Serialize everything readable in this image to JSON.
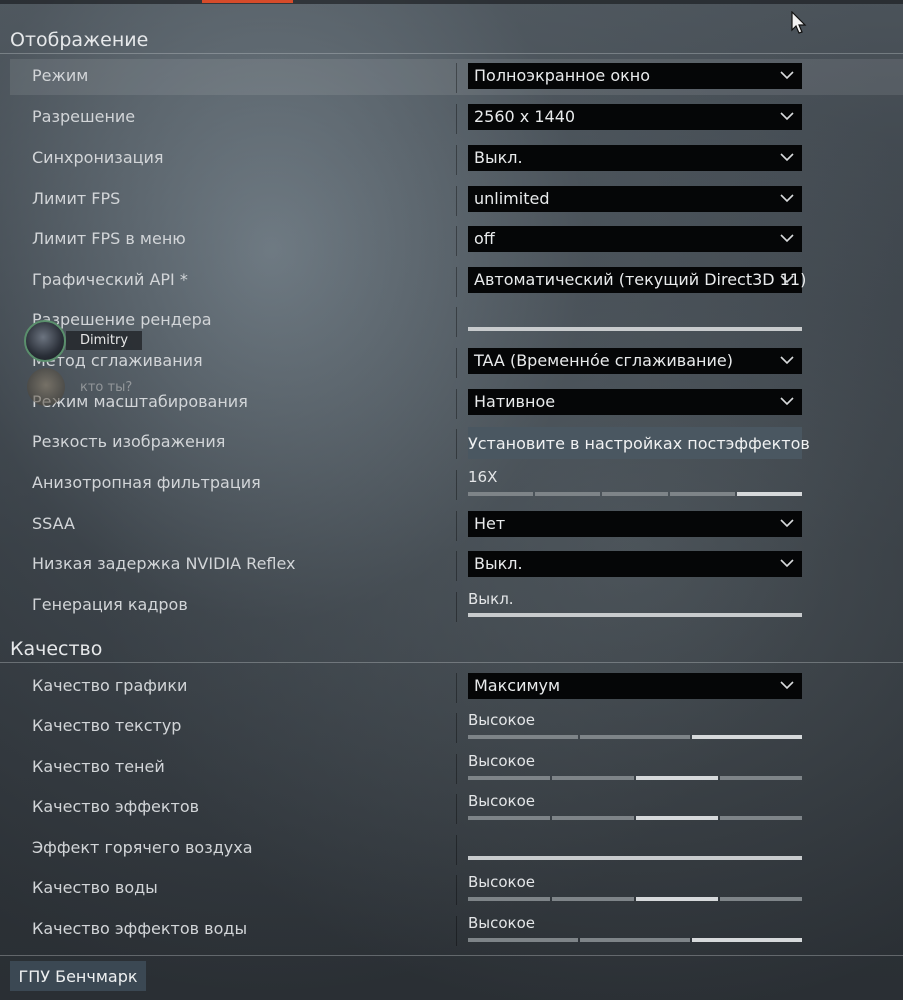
{
  "sections": {
    "display": "Отображение",
    "quality": "Качество"
  },
  "rows": {
    "mode": {
      "label": "Режим",
      "value": "Полноэкранное окно"
    },
    "resolution": {
      "label": "Разрешение",
      "value": "2560 x 1440"
    },
    "vsync": {
      "label": "Синхронизация",
      "value": "Выкл."
    },
    "fps_limit": {
      "label": "Лимит FPS",
      "value": "unlimited"
    },
    "fps_limit_menu": {
      "label": "Лимит FPS в меню",
      "value": "off"
    },
    "graphics_api": {
      "label": "Графический API *",
      "value": "Автоматический (текущий Direct3D 11)"
    },
    "render_res": {
      "label": "Разрешение рендера"
    },
    "antialias": {
      "label": "Метод сглаживания",
      "value": "TAA (Временно́е сглаживание)"
    },
    "scaling": {
      "label": "Режим масштабирования",
      "value": "Нативное"
    },
    "sharpness": {
      "label": "Резкость изображения",
      "button": "Установите в настройках постэффектов"
    },
    "anisotropic": {
      "label": "Анизотропная фильтрация",
      "value": "16X",
      "level": 5,
      "steps": 5
    },
    "ssaa": {
      "label": "SSAA",
      "value": "Нет"
    },
    "reflex": {
      "label": "Низкая задержка NVIDIA Reflex",
      "value": "Выкл."
    },
    "framegen": {
      "label": "Генерация кадров",
      "value": "Выкл."
    },
    "gfx_quality": {
      "label": "Качество графики",
      "value": "Максимум"
    },
    "texture_quality": {
      "label": "Качество текстур",
      "value": "Высокое",
      "level": 3,
      "steps": 3
    },
    "shadow_quality": {
      "label": "Качество теней",
      "value": "Высокое",
      "level": 3,
      "steps": 4
    },
    "effects_quality": {
      "label": "Качество эффектов",
      "value": "Высокое",
      "level": 3,
      "steps": 4
    },
    "heat_haze": {
      "label": "Эффект горячего воздуха"
    },
    "water_quality": {
      "label": "Качество воды",
      "value": "Высокое",
      "level": 3,
      "steps": 4
    },
    "water_fx_quality": {
      "label": "Качество эффектов воды",
      "value": "Высокое",
      "level": 3,
      "steps": 3
    }
  },
  "overlay": {
    "user1": "Dimitry",
    "user2": "кто ты?"
  },
  "benchmark": "ГПУ Бенчмарк",
  "colors": {
    "accent": "#d64b2a",
    "segment_on": "#d6d9db",
    "segment_off": "#7e8488"
  }
}
